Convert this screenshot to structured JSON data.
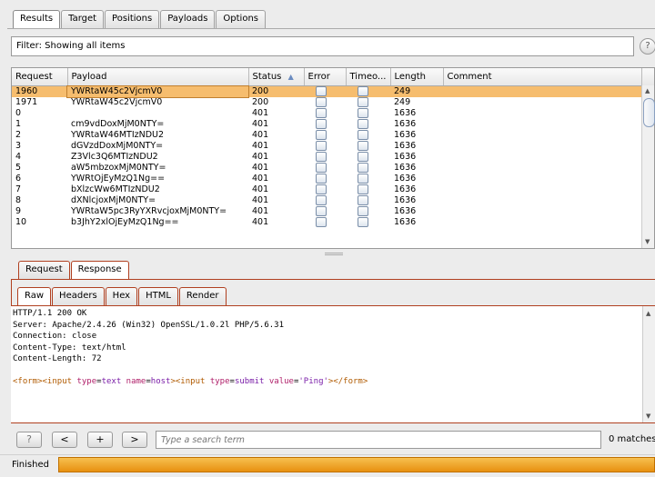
{
  "top_tabs": [
    "Results",
    "Target",
    "Positions",
    "Payloads",
    "Options"
  ],
  "filter": {
    "text": "Filter: Showing all items",
    "help": "?"
  },
  "table": {
    "columns": [
      "Request",
      "Payload",
      "Status",
      "Error",
      "Timeo...",
      "Length",
      "Comment"
    ],
    "sort_indicator": "▲",
    "rows": [
      {
        "request": "1960",
        "payload": "YWRtaW45c2VjcmV0",
        "status": "200",
        "length": "249",
        "comment": ""
      },
      {
        "request": "1971",
        "payload": "YWRtaW45c2VjcmV0",
        "status": "200",
        "length": "249",
        "comment": ""
      },
      {
        "request": "0",
        "payload": "",
        "status": "401",
        "length": "1636",
        "comment": ""
      },
      {
        "request": "1",
        "payload": "cm9vdDoxMjM0NTY=",
        "status": "401",
        "length": "1636",
        "comment": ""
      },
      {
        "request": "2",
        "payload": "YWRtaW46MTIzNDU2",
        "status": "401",
        "length": "1636",
        "comment": ""
      },
      {
        "request": "3",
        "payload": "dGVzdDoxMjM0NTY=",
        "status": "401",
        "length": "1636",
        "comment": ""
      },
      {
        "request": "4",
        "payload": "Z3Vlc3Q6MTIzNDU2",
        "status": "401",
        "length": "1636",
        "comment": ""
      },
      {
        "request": "5",
        "payload": "aW5mbzoxMjM0NTY=",
        "status": "401",
        "length": "1636",
        "comment": ""
      },
      {
        "request": "6",
        "payload": "YWRtOjEyMzQ1Ng==",
        "status": "401",
        "length": "1636",
        "comment": ""
      },
      {
        "request": "7",
        "payload": "bXlzcWw6MTIzNDU2",
        "status": "401",
        "length": "1636",
        "comment": ""
      },
      {
        "request": "8",
        "payload": "dXNlcjoxMjM0NTY=",
        "status": "401",
        "length": "1636",
        "comment": ""
      },
      {
        "request": "9",
        "payload": "YWRtaW5pc3RyYXRvcjoxMjM0NTY=",
        "status": "401",
        "length": "1636",
        "comment": ""
      },
      {
        "request": "10",
        "payload": "b3JhY2xlOjEyMzQ1Ng==",
        "status": "401",
        "length": "1636",
        "comment": ""
      }
    ]
  },
  "req_resp_tabs": [
    "Request",
    "Response"
  ],
  "view_tabs": [
    "Raw",
    "Headers",
    "Hex",
    "HTML",
    "Render"
  ],
  "response": {
    "headers": [
      "HTTP/1.1 200 OK",
      "Server: Apache/2.4.26 (Win32) OpenSSL/1.0.2l PHP/5.6.31",
      "Connection: close",
      "Content-Type: text/html",
      "Content-Length: 72"
    ],
    "body": {
      "form_open": "<form>",
      "input1_open": "<input",
      "type_attr": "type",
      "type_text": "text",
      "name_attr": "name",
      "name_val": "host",
      "close1": ">",
      "input2_open": "<input",
      "type_attr2": "type",
      "type_submit": "submit",
      "value_attr": "value",
      "value_val": "'Ping'",
      "close2": ">",
      "form_close": "</form>",
      "eq": "="
    }
  },
  "search": {
    "buttons": [
      "?",
      "<",
      "+",
      ">"
    ],
    "placeholder": "Type a search term",
    "matches": "0 matches"
  },
  "status": {
    "text": "Finished",
    "progress": 1.0,
    "progress_color": "#f0a020"
  }
}
